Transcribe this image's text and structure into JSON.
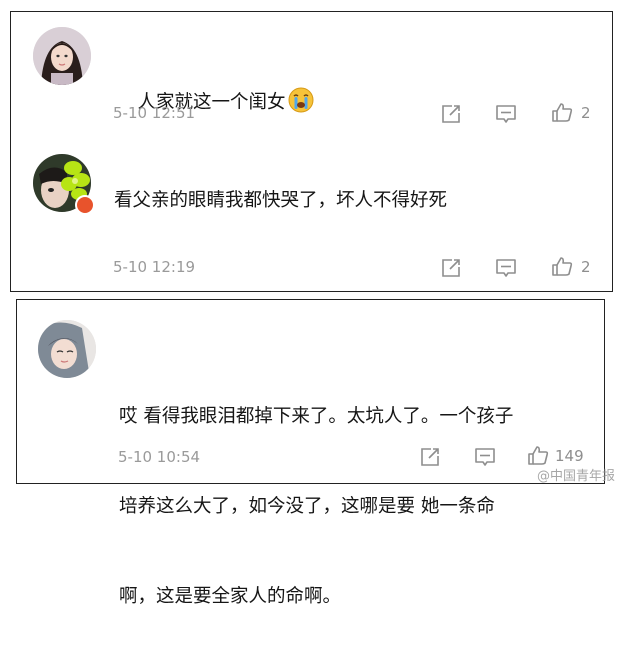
{
  "comments": [
    {
      "text": "人家就这一个闺女",
      "emoji": "crying-face-emoji",
      "time": "5-10 12:51",
      "likes": "2"
    },
    {
      "text": "看父亲的眼睛我都快哭了，坏人不得好死",
      "time": "5-10 12:19",
      "likes": "2"
    },
    {
      "lines": [
        "哎 看得我眼泪都掉下来了。太坑人了。一个孩子",
        "培养这么大了，如今没了，这哪是要 她一条命",
        "啊，这是要全家人的命啊。"
      ],
      "time": "5-10 10:54",
      "likes": "149"
    }
  ],
  "watermark": "@中国青年报",
  "colors": {
    "text": "#161616",
    "meta": "#9a9a9a",
    "icon": "#8e8e8e",
    "badge": "#e8532c"
  }
}
